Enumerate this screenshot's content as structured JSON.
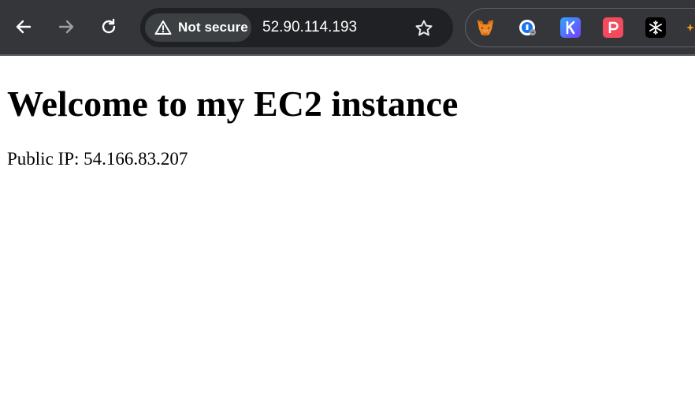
{
  "browser": {
    "security_chip": {
      "label": "Not secure"
    },
    "address_bar": {
      "url": "52.90.114.193"
    },
    "extensions": [
      {
        "name": "MetaMask",
        "icon": "fox-icon"
      },
      {
        "name": "Extension",
        "icon": "shield-icon"
      },
      {
        "name": "Extension",
        "icon": "k-icon"
      },
      {
        "name": "Extension",
        "icon": "p-icon"
      },
      {
        "name": "Extension",
        "icon": "snowflake-icon"
      },
      {
        "name": "Extension",
        "icon": "star-icon"
      }
    ]
  },
  "page": {
    "heading": "Welcome to my EC2 instance",
    "public_ip_text": "Public IP: 54.166.83.207"
  },
  "colors": {
    "toolbar_bg": "#35363a",
    "omnibox_bg": "#202124",
    "chip_bg": "#3c4043",
    "page_bg": "#ffffff"
  }
}
